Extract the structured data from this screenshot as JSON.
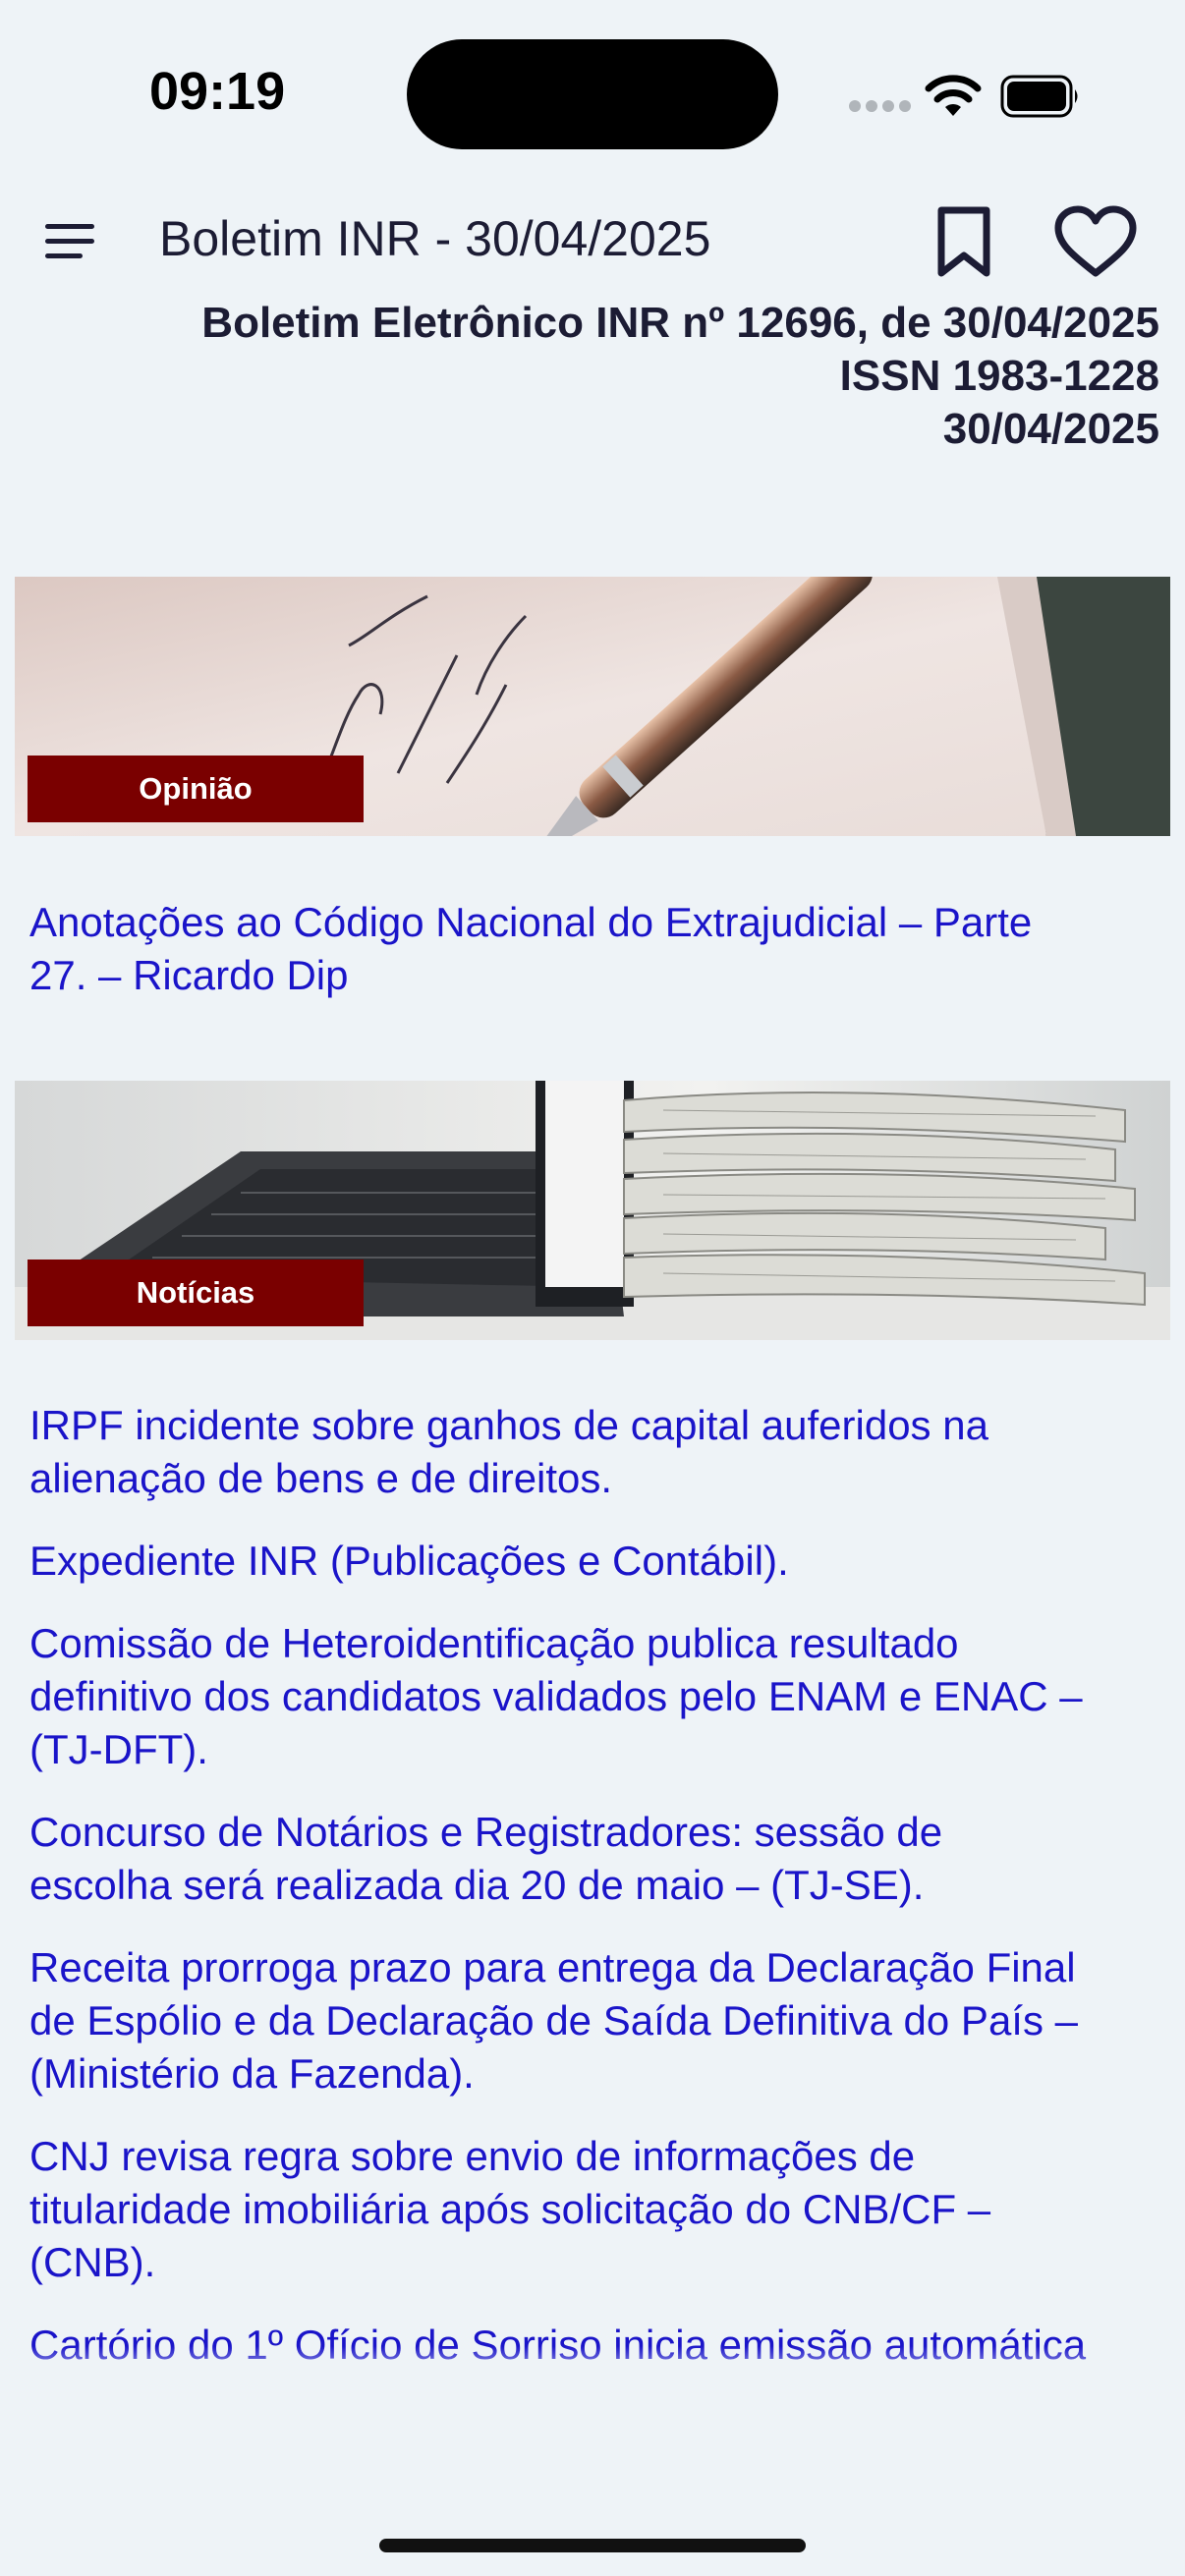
{
  "status_bar": {
    "time": "09:19"
  },
  "header": {
    "title": "Boletim INR - 30/04/2025",
    "icons": [
      "menu-icon",
      "bookmark-icon",
      "heart-icon"
    ]
  },
  "bulletin": {
    "line1": "Boletim Eletrônico INR nº 12696, de 30/04/2025",
    "line2": "ISSN 1983-1228",
    "line3": "30/04/2025"
  },
  "sections": {
    "opinion": {
      "tag": "Opinião",
      "articles": [
        "Anotações ao Código Nacional do Extrajudicial – Parte\n27.   – Ricardo Dip"
      ]
    },
    "news": {
      "tag": "Notícias",
      "articles": [
        "IRPF incidente sobre ganhos de capital auferidos na\nalienação de bens e de direitos.",
        "Expediente INR (Publicações e Contábil).",
        "Comissão de Heteroidentificação publica resultado\ndefinitivo dos candidatos validados pelo ENAM e ENAC –\n(TJ-DFT).",
        "Concurso de Notários e Registradores: sessão de\nescolha será realizada dia 20 de maio – (TJ-SE).",
        "Receita prorroga prazo para entrega da Declaração Final\nde Espólio e da Declaração de Saída Definitiva do País –\n(Ministério da Fazenda).",
        "CNJ revisa regra sobre envio de informações de\ntitularidade imobiliária após solicitação do CNB/CF –\n(CNB).",
        "Cartório do 1º Ofício de Sorriso inicia emissão automática"
      ]
    }
  },
  "colors": {
    "background": "#eef3f7",
    "link": "#1a14c9",
    "tag": "#7a0000",
    "text": "#1c1c34"
  }
}
